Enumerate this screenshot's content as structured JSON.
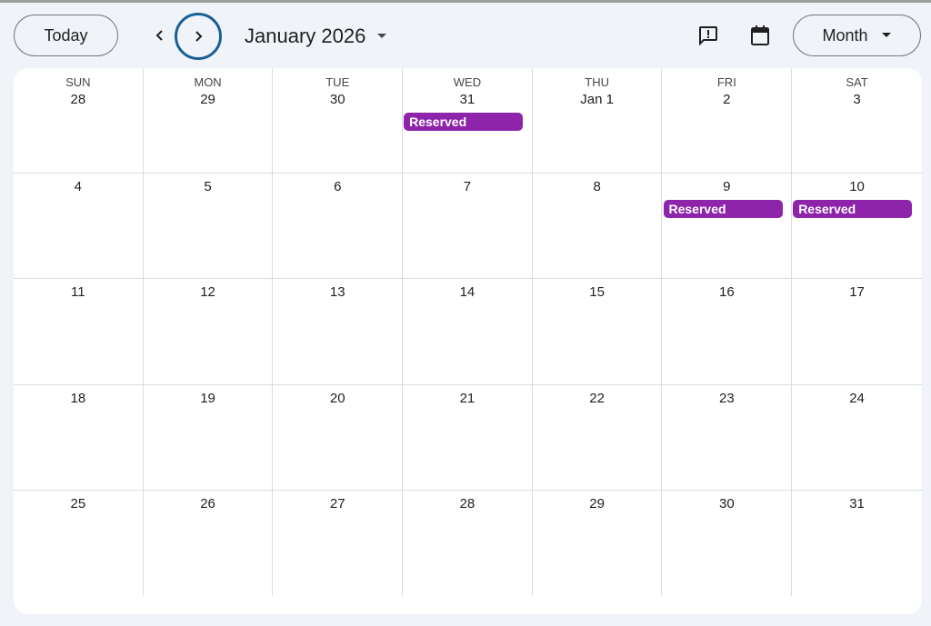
{
  "toolbar": {
    "today_label": "Today",
    "prev_icon": "chevron-left-icon",
    "next_icon": "chevron-right-icon",
    "month_title": "January 2026",
    "view_label": "Month",
    "feedback_icon": "feedback-icon",
    "calendar_icon": "calendar-icon"
  },
  "weekdays": [
    "SUN",
    "MON",
    "TUE",
    "WED",
    "THU",
    "FRI",
    "SAT"
  ],
  "weeks": [
    [
      "28",
      "29",
      "30",
      "31",
      "Jan 1",
      "2",
      "3"
    ],
    [
      "4",
      "5",
      "6",
      "7",
      "8",
      "9",
      "10"
    ],
    [
      "11",
      "12",
      "13",
      "14",
      "15",
      "16",
      "17"
    ],
    [
      "18",
      "19",
      "20",
      "21",
      "22",
      "23",
      "24"
    ],
    [
      "25",
      "26",
      "27",
      "28",
      "29",
      "30",
      "31"
    ]
  ],
  "events": [
    {
      "week": 0,
      "day": 3,
      "label": "Reserved"
    },
    {
      "week": 1,
      "day": 5,
      "label": "Reserved"
    },
    {
      "week": 1,
      "day": 6,
      "label": "Reserved"
    }
  ],
  "colors": {
    "event": "#8e24aa",
    "focus_ring": "#1a5f96",
    "background": "#f0f4f9"
  }
}
